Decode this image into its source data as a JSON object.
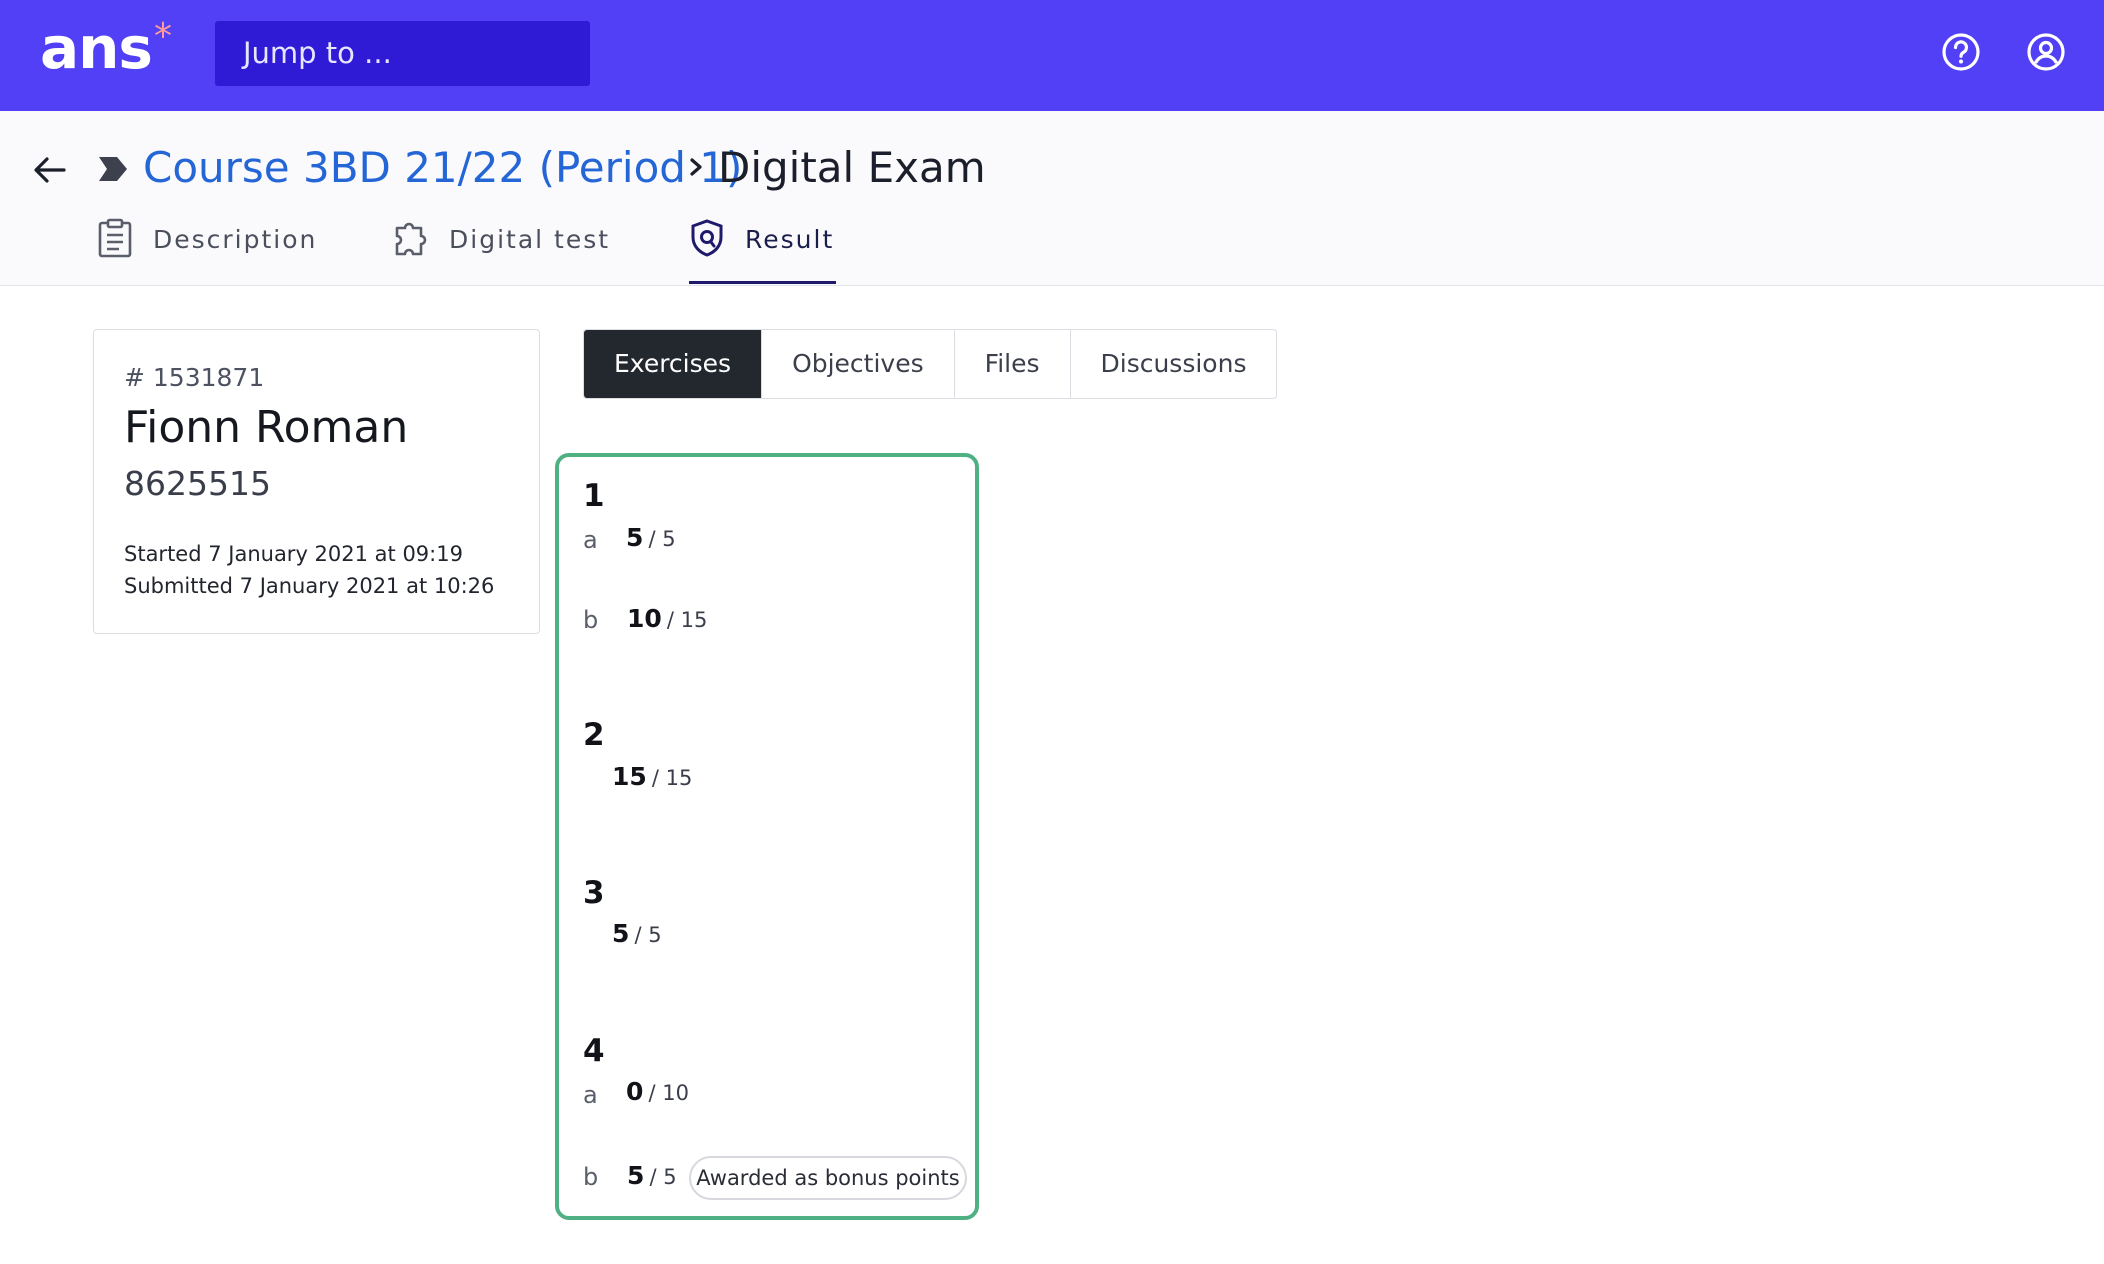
{
  "topbar": {
    "logo_text": "ans",
    "logo_star": "*",
    "jump_placeholder": "Jump to ...",
    "help_icon": "help-circle-icon",
    "user_icon": "user-circle-icon"
  },
  "breadcrumb": {
    "course": "Course 3BD 21/22 (Period 1)",
    "current": "Digital Exam"
  },
  "tabs": [
    {
      "label": "Description",
      "icon": "clipboard-icon"
    },
    {
      "label": "Digital test",
      "icon": "puzzle-icon"
    },
    {
      "label": "Result",
      "icon": "shield-icon",
      "active": true
    }
  ],
  "student": {
    "id": "# 1531871",
    "name": "Fionn Roman",
    "number": "8625515",
    "started": "Started 7 January 2021 at 09:19",
    "submitted": "Submitted 7 January 2021 at 10:26"
  },
  "result_tabs": [
    {
      "label": "Exercises",
      "active": true
    },
    {
      "label": "Objectives"
    },
    {
      "label": "Files"
    },
    {
      "label": "Discussions"
    }
  ],
  "exercises": {
    "e1": {
      "number": "1",
      "a": {
        "label": "a",
        "points": "5",
        "max": "/ 5"
      },
      "b": {
        "label": "b",
        "points": "10",
        "max": "/ 15"
      }
    },
    "e2": {
      "number": "2",
      "score": {
        "points": "15",
        "max": "/ 15"
      }
    },
    "e3": {
      "number": "3",
      "score": {
        "points": "5",
        "max": "/ 5"
      }
    },
    "e4": {
      "number": "4",
      "a": {
        "label": "a",
        "points": "0",
        "max": "/ 10"
      },
      "b": {
        "label": "b",
        "points": "5",
        "max": "/ 5",
        "badge": "Awarded as bonus points"
      }
    }
  },
  "colors": {
    "topbar": "#5140f5",
    "jump_bg": "#2f1bd6",
    "link": "#2566d6",
    "panel_border": "#4fb083",
    "active_tab": "#23272e"
  }
}
